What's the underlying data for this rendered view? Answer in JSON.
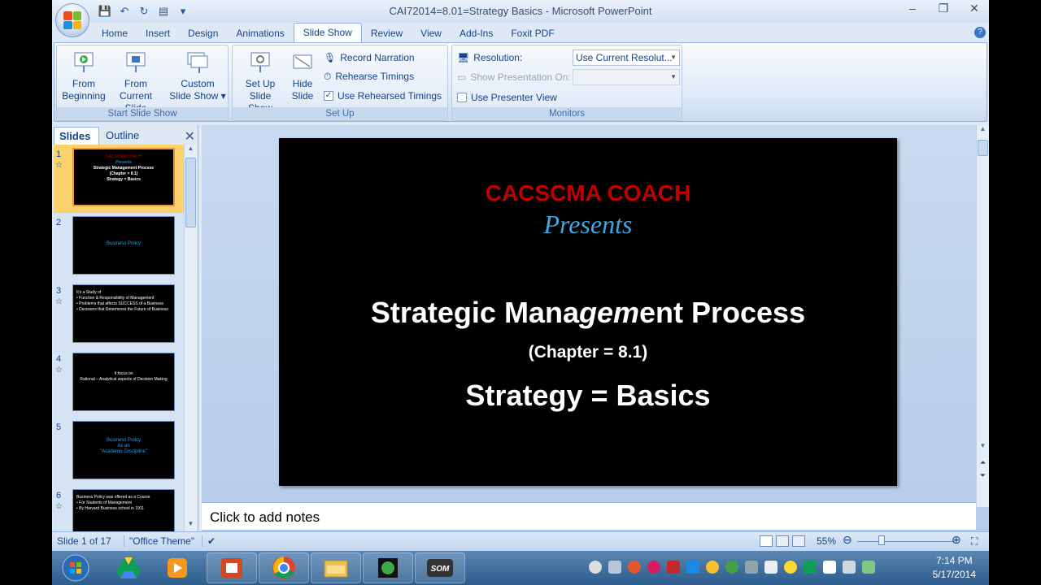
{
  "window": {
    "title": "CAI72014=8.01=Strategy Basics - Microsoft PowerPoint",
    "controls": [
      "–",
      "❐",
      "✕"
    ]
  },
  "ribbon_tabs": [
    "Home",
    "Insert",
    "Design",
    "Animations",
    "Slide Show",
    "Review",
    "View",
    "Add-Ins",
    "Foxit PDF"
  ],
  "active_tab": "Slide Show",
  "ribbon": {
    "start_group": {
      "label": "Start Slide Show",
      "from_beginning": [
        "From",
        "Beginning"
      ],
      "from_current": [
        "From",
        "Current Slide"
      ],
      "custom": [
        "Custom",
        "Slide Show ▾"
      ]
    },
    "setup_group": {
      "label": "Set Up",
      "setup_show": [
        "Set Up",
        "Slide Show"
      ],
      "hide_slide": [
        "Hide",
        "Slide"
      ],
      "record_narration": "Record Narration",
      "rehearse_timings": "Rehearse Timings",
      "use_rehearsed": "Use Rehearsed Timings",
      "use_rehearsed_checked": true
    },
    "monitors_group": {
      "label": "Monitors",
      "resolution_label": "Resolution:",
      "resolution_value": "Use Current Resolut...",
      "show_on_label": "Show Presentation On:",
      "presenter_view": "Use Presenter View",
      "presenter_view_checked": false
    }
  },
  "left_pane": {
    "tab_slides": "Slides",
    "tab_outline": "Outline",
    "close": "✕",
    "thumbnails": [
      {
        "num": "1",
        "lines": [
          "CACSCMA COACH",
          "Presents",
          "Strategic Management Process",
          "(Chapter = 8.1)",
          "Strategy = Basics"
        ],
        "selected": true,
        "anim": true
      },
      {
        "num": "2",
        "lines": [
          "Business Policy"
        ],
        "selected": false,
        "anim": false
      },
      {
        "num": "3",
        "lines": [
          "It's a Study of",
          "• Function & Responsibility of Management",
          "• Problems that affects SUCCESS of a Business",
          "• Decisions that Determines the Future of Business"
        ],
        "selected": false,
        "anim": true
      },
      {
        "num": "4",
        "lines": [
          "It focus on",
          "Rational – Analytical aspects of Decision Making"
        ],
        "selected": false,
        "anim": true
      },
      {
        "num": "5",
        "lines": [
          "Business Policy",
          "As an",
          "\"Academic Discipline\""
        ],
        "selected": false,
        "anim": false
      },
      {
        "num": "6",
        "lines": [
          "Business Policy was offered as a Course",
          "• For Students of Management",
          "• By Harvard Business school in 1911"
        ],
        "selected": false,
        "anim": true
      }
    ]
  },
  "slide": {
    "brand": "CACSCMA COACH",
    "presents": "Presents",
    "title_a": "Strategic Mana",
    "title_b": "gem",
    "title_c": "ent Process",
    "chapter": "(Chapter = 8.1)",
    "subtitle": "Strategy = Basics"
  },
  "notes_placeholder": "Click to add notes",
  "status_bar": {
    "slide_info": "Slide 1 of 17",
    "theme": "\"Office Theme\"",
    "zoom": "55%"
  },
  "taskbar": {
    "time": "7:14 PM",
    "date": "5/17/2014"
  },
  "colors": {
    "brand_red": "#c00000",
    "presents_blue": "#3fa7e3",
    "thumb_blue": "#29a3e8"
  }
}
